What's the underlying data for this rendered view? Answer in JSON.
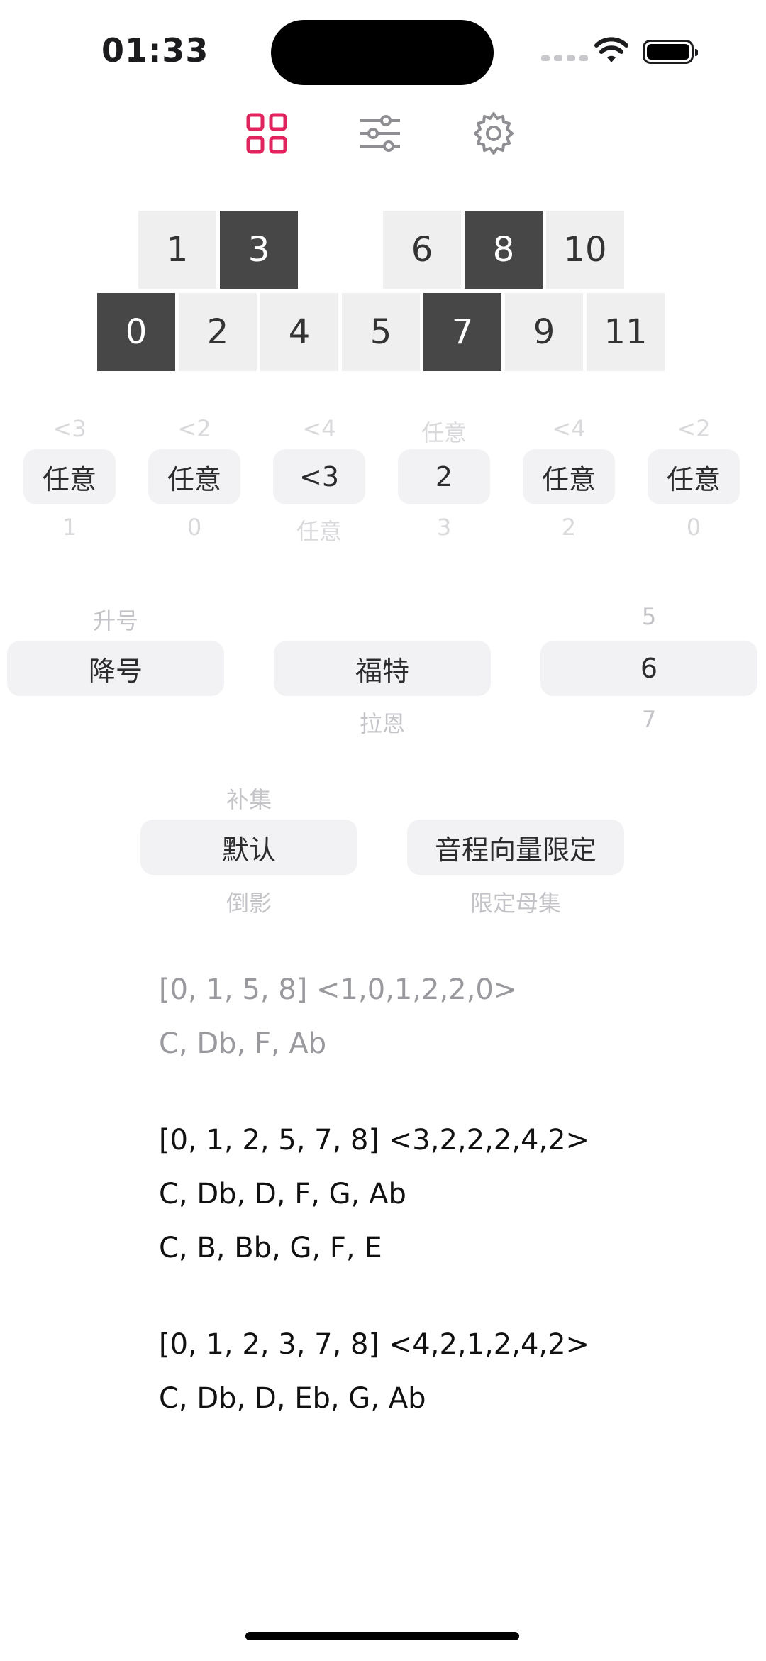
{
  "status_bar": {
    "time": "01:33"
  },
  "toolbar": {
    "items": [
      {
        "name": "grid-icon",
        "active": true
      },
      {
        "name": "sliders-icon",
        "active": false
      },
      {
        "name": "gear-icon",
        "active": false
      }
    ],
    "accent_color": "#e0245e"
  },
  "keyboard": {
    "top_row": [
      {
        "label": "1",
        "on": false
      },
      {
        "label": "3",
        "on": true
      },
      {
        "label": "6",
        "on": false
      },
      {
        "label": "8",
        "on": true
      },
      {
        "label": "10",
        "on": false
      }
    ],
    "bottom_row": [
      {
        "label": "0",
        "on": true
      },
      {
        "label": "2",
        "on": false
      },
      {
        "label": "4",
        "on": false
      },
      {
        "label": "5",
        "on": false
      },
      {
        "label": "7",
        "on": true
      },
      {
        "label": "9",
        "on": false
      },
      {
        "label": "11",
        "on": false
      }
    ]
  },
  "interval_pickers": [
    {
      "above": "<3",
      "selected": "任意",
      "below": "1"
    },
    {
      "above": "<2",
      "selected": "任意",
      "below": "0"
    },
    {
      "above": "<4",
      "selected": "<3",
      "below": "任意"
    },
    {
      "above": "任意",
      "selected": "2",
      "below": "3"
    },
    {
      "above": "<4",
      "selected": "任意",
      "below": "2"
    },
    {
      "above": "<2",
      "selected": "任意",
      "below": "0"
    }
  ],
  "option_pickers_1": [
    {
      "above": "升号",
      "selected": "降号",
      "below": ""
    },
    {
      "above": "",
      "selected": "福特",
      "below": "拉恩"
    },
    {
      "above": "5",
      "selected": "6",
      "below": "7"
    }
  ],
  "option_pickers_2": [
    {
      "above": "补集",
      "selected": "默认",
      "below": "倒影"
    },
    {
      "above": "",
      "selected": "音程向量限定",
      "below": "限定母集"
    }
  ],
  "results": [
    {
      "line1": "[0, 1, 5, 8]  <1,0,1,2,2,0>",
      "line2": "C, Db, F, Ab"
    },
    {
      "line1": "[0, 1, 2, 5, 7, 8]  <3,2,2,2,4,2>",
      "line2": "C, Db, D, F, G, Ab",
      "line3": "C, B, Bb, G, F, E"
    },
    {
      "line1": "[0, 1, 2, 3, 7, 8]  <4,2,1,2,4,2>",
      "line2": "C, Db, D, Eb, G, Ab"
    }
  ]
}
